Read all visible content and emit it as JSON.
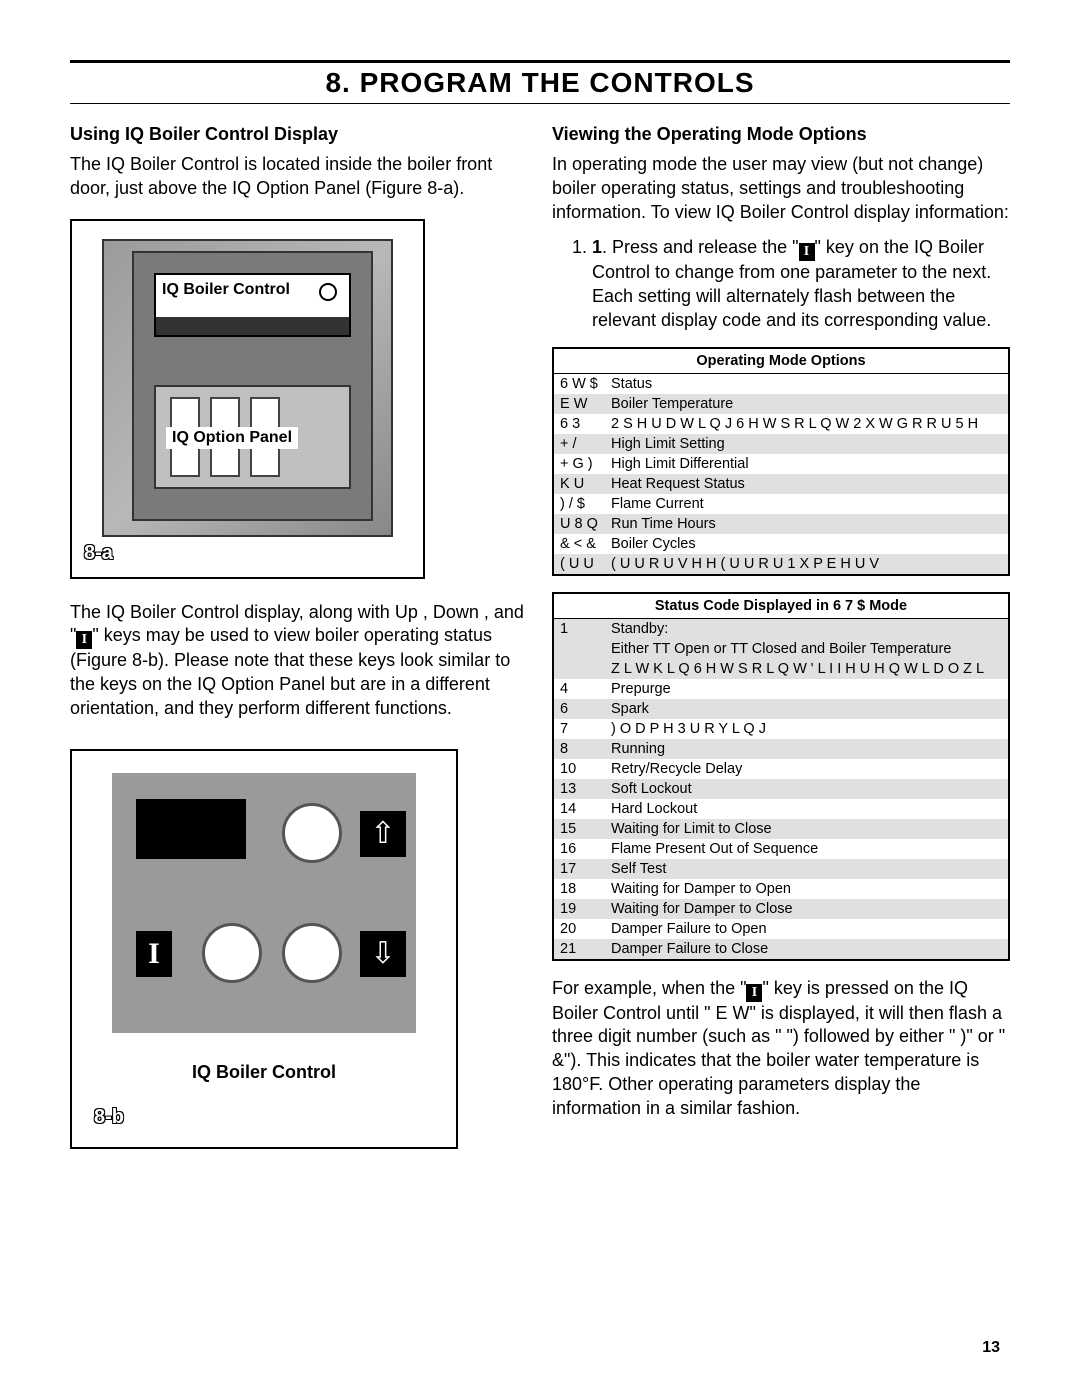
{
  "title": "8.  PROGRAM THE CONTROLS",
  "page_number": "13",
  "left": {
    "h_using": "Using IQ Boiler Control Display",
    "p1": "The IQ Boiler Control is located inside the boiler front door, just above the IQ Option Panel (Figure 8-a).",
    "fig_a_label_top": "IQ Boiler Control",
    "fig_a_label_bottom": "IQ Option Panel",
    "fig_a_tag": "8-a",
    "p2_pre": "The IQ Boiler Control display, along with Up   , Down   , and \"",
    "p2_post": "\" keys may be used to view boiler operating status (Figure 8-b).  Please note that these keys look similar to the keys on the IQ Option Panel but are in a different orientation, and they perform different functions.",
    "fig_b_caption": "IQ Boiler Control",
    "fig_b_tag": "8-b"
  },
  "right": {
    "h_view": "Viewing the Operating Mode Options",
    "p1": "In operating mode the user may view (but not change) boiler operating status, settings and troubleshooting information.  To view IQ Boiler Control display information:",
    "step1_pre": "Press and release the \"",
    "step1_post": "\" key on the IQ Boiler Control to change from one parameter to the next. Each setting will alternately flash between the relevant display code and its corresponding value.",
    "table1_header": "Operating Mode Options",
    "table1": [
      {
        "c": "6 W $",
        "d": "Status"
      },
      {
        "c": "E W",
        "d": "Boiler Temperature"
      },
      {
        "c": "6 3",
        "d": "2 S H U D W L Q J   6 H W S R L Q W     2 X W G R R U   5 H"
      },
      {
        "c": "+ /",
        "d": "High Limit Setting"
      },
      {
        "c": "+ G )",
        "d": "High Limit Differential"
      },
      {
        "c": "K U",
        "d": "Heat Request Status"
      },
      {
        "c": ") / $",
        "d": "Flame Current"
      },
      {
        "c": "U 8 Q",
        "d": "Run Time Hours"
      },
      {
        "c": "& < &",
        "d": "Boiler Cycles"
      },
      {
        "c": "( U U",
        "d": "( U U R U     V H H   ( U U R U   1 X P E H U V"
      }
    ],
    "table2_header": "Status Code Displayed in  6 7 $ Mode",
    "table2": [
      {
        "n": "1",
        "d": "Standby:"
      },
      {
        "n": "",
        "d": "Either TT Open or TT Closed and Boiler Temperature"
      },
      {
        "n": "",
        "d": "Z L W K L Q   6 H W S R L Q W     ' L I I H U H Q W L D O   Z L"
      },
      {
        "n": "4",
        "d": "Prepurge"
      },
      {
        "n": "6",
        "d": "Spark"
      },
      {
        "n": "7",
        "d": ") O D P H   3 U R Y L Q J"
      },
      {
        "n": "8",
        "d": "Running"
      },
      {
        "n": "10",
        "d": "Retry/Recycle Delay"
      },
      {
        "n": "13",
        "d": "Soft Lockout"
      },
      {
        "n": "14",
        "d": "Hard Lockout"
      },
      {
        "n": "15",
        "d": "Waiting for Limit to Close"
      },
      {
        "n": "16",
        "d": "Flame Present Out of Sequence"
      },
      {
        "n": "17",
        "d": "Self Test"
      },
      {
        "n": "18",
        "d": "Waiting for Damper to Open"
      },
      {
        "n": "19",
        "d": "Waiting for Damper to Close"
      },
      {
        "n": "20",
        "d": "Damper Failure to Open"
      },
      {
        "n": "21",
        "d": "Damper Failure to Close"
      }
    ],
    "p2_a": "For example, when the \"",
    "p2_b": "\" key is pressed on the IQ Boiler Control until \" E W\" is displayed, it will then flash a three digit number (such as \"     \") followed by either \" )\" or \" &\").  This indicates that the boiler water temperature is  180°F.  Other operating parameters display the information in a similar fashion."
  }
}
